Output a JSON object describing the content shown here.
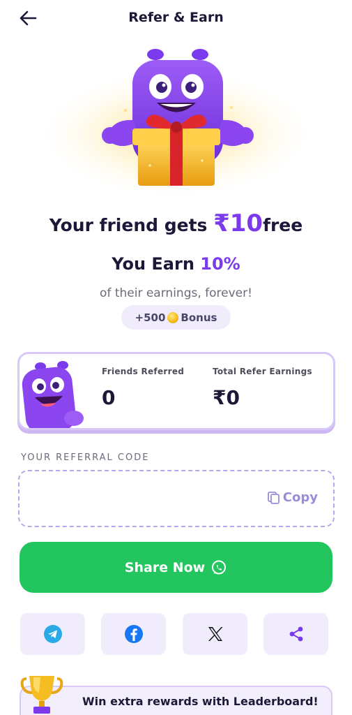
{
  "header": {
    "title": "Refer & Earn"
  },
  "offer": {
    "friend_prefix": "Your friend gets ",
    "friend_amount": "₹10",
    "friend_suffix": "free",
    "earn_prefix": "You Earn ",
    "earn_pct": "10%",
    "subtitle": "of their earnings, forever!",
    "bonus_amount": "+500",
    "bonus_label": "Bonus"
  },
  "stats": {
    "friends_label": "Friends Referred",
    "friends_value": "0",
    "earnings_label": "Total Refer Earnings",
    "earnings_value": "₹0"
  },
  "referral": {
    "label": "YOUR REFERRAL CODE",
    "code": "",
    "copy_label": "Copy"
  },
  "share": {
    "label": "Share Now"
  },
  "social_icons": [
    "telegram-icon",
    "facebook-icon",
    "x-icon",
    "share-icon"
  ],
  "leaderboard": {
    "text": "Win extra rewards with Leaderboard!"
  },
  "colors": {
    "accent": "#7c3aed",
    "share_green": "#22c55e",
    "card_border": "#d8c8f6",
    "tile_bg": "#f1ecfb"
  }
}
